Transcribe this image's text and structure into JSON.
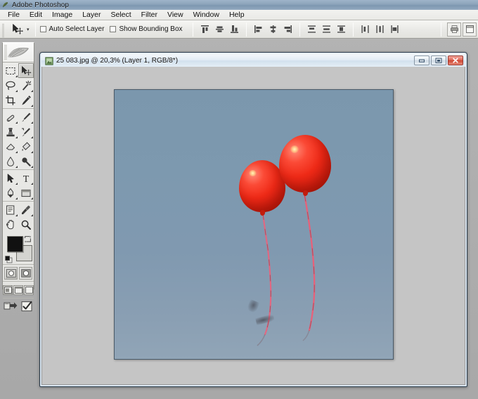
{
  "app": {
    "title": "Adobe Photoshop",
    "icon": "photoshop-icon"
  },
  "menubar": {
    "items": [
      {
        "label": "File"
      },
      {
        "label": "Edit"
      },
      {
        "label": "Image"
      },
      {
        "label": "Layer"
      },
      {
        "label": "Select"
      },
      {
        "label": "Filter"
      },
      {
        "label": "View"
      },
      {
        "label": "Window"
      },
      {
        "label": "Help"
      }
    ]
  },
  "options_bar": {
    "active_tool_icon": "move-tool-icon",
    "preset_caret": "▾",
    "auto_select_layer": {
      "label": "Auto Select Layer",
      "checked": false
    },
    "show_bounding_box": {
      "label": "Show Bounding Box",
      "checked": false
    },
    "align_buttons": [
      {
        "name": "align-top-edges"
      },
      {
        "name": "align-vertical-centers"
      },
      {
        "name": "align-bottom-edges"
      },
      {
        "name": "align-left-edges"
      },
      {
        "name": "align-horizontal-centers"
      },
      {
        "name": "align-right-edges"
      }
    ],
    "distribute_buttons": [
      {
        "name": "distribute-top-edges"
      },
      {
        "name": "distribute-vertical-centers"
      },
      {
        "name": "distribute-bottom-edges"
      },
      {
        "name": "distribute-left-edges"
      },
      {
        "name": "distribute-horizontal-centers"
      },
      {
        "name": "distribute-right-edges"
      }
    ],
    "palette_well": [
      {
        "name": "print-icon"
      },
      {
        "name": "palette-dock-icon"
      }
    ]
  },
  "toolbox": {
    "groups": [
      {
        "tools": [
          {
            "name": "rectangular-marquee-tool",
            "selected": false,
            "has_flyout": true
          },
          {
            "name": "move-tool",
            "selected": true,
            "has_flyout": false
          },
          {
            "name": "lasso-tool",
            "selected": false,
            "has_flyout": true
          },
          {
            "name": "magic-wand-tool",
            "selected": false,
            "has_flyout": true
          },
          {
            "name": "crop-tool",
            "selected": false,
            "has_flyout": false
          },
          {
            "name": "slice-tool",
            "selected": false,
            "has_flyout": true
          }
        ]
      },
      {
        "tools": [
          {
            "name": "healing-brush-tool",
            "selected": false,
            "has_flyout": true
          },
          {
            "name": "brush-tool",
            "selected": false,
            "has_flyout": true
          },
          {
            "name": "clone-stamp-tool",
            "selected": false,
            "has_flyout": true
          },
          {
            "name": "history-brush-tool",
            "selected": false,
            "has_flyout": true
          },
          {
            "name": "eraser-tool",
            "selected": false,
            "has_flyout": true
          },
          {
            "name": "gradient-tool",
            "selected": false,
            "has_flyout": true
          },
          {
            "name": "blur-tool",
            "selected": false,
            "has_flyout": true
          },
          {
            "name": "dodge-tool",
            "selected": false,
            "has_flyout": true
          }
        ]
      },
      {
        "tools": [
          {
            "name": "path-selection-tool",
            "selected": false,
            "has_flyout": true
          },
          {
            "name": "type-tool",
            "selected": false,
            "has_flyout": true
          },
          {
            "name": "pen-tool",
            "selected": false,
            "has_flyout": true
          },
          {
            "name": "shape-tool",
            "selected": false,
            "has_flyout": true
          }
        ]
      },
      {
        "tools": [
          {
            "name": "notes-tool",
            "selected": false,
            "has_flyout": true
          },
          {
            "name": "eyedropper-tool",
            "selected": false,
            "has_flyout": true
          },
          {
            "name": "hand-tool",
            "selected": false,
            "has_flyout": false
          },
          {
            "name": "zoom-tool",
            "selected": false,
            "has_flyout": false
          }
        ]
      }
    ],
    "colors": {
      "foreground": "#111111",
      "background": "#d4d4d0",
      "swap_icon": "swap-colors-icon",
      "default_icon": "default-colors-icon"
    },
    "quick_mask": [
      {
        "name": "standard-mode-button",
        "active": true
      },
      {
        "name": "quick-mask-mode-button",
        "active": false
      }
    ],
    "screen_modes": [
      {
        "name": "standard-screen-mode-button",
        "active": true
      },
      {
        "name": "full-screen-with-menubar-button",
        "active": false
      },
      {
        "name": "full-screen-mode-button",
        "active": false
      }
    ],
    "jump_to": [
      {
        "name": "jump-to-imageready-button"
      },
      {
        "name": "checkmark-button"
      }
    ]
  },
  "document": {
    "icon": "document-icon",
    "title": "25 083.jpg @ 20,3% (Layer 1, RGB/8*)",
    "filename": "25 083.jpg",
    "zoom": "20,3%",
    "layer": "Layer 1",
    "color_mode": "RGB/8*",
    "window_buttons": [
      {
        "name": "minimize-button",
        "glyph": "minimize"
      },
      {
        "name": "restore-button",
        "glyph": "restore"
      },
      {
        "name": "close-button",
        "glyph": "close"
      }
    ],
    "canvas": {
      "description": "Two red balloons with trailing pink ribbons against a grey-blue sky",
      "sky_color": "#7b97ad",
      "balloon_color": "#ef2a17",
      "ribbon_color": "#e8607a"
    }
  }
}
